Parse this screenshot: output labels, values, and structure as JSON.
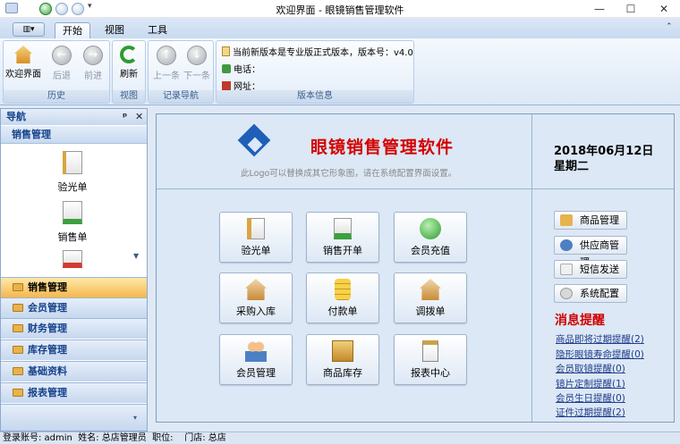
{
  "window": {
    "title": "欢迎界面 - 眼镜销售管理软件",
    "min": "—",
    "max": "☐",
    "close": "✕"
  },
  "tabs": [
    {
      "label": "开始"
    },
    {
      "label": "视图"
    },
    {
      "label": "工具"
    }
  ],
  "ribbon": {
    "history": {
      "label": "历史",
      "welcome": "欢迎界面",
      "back": "后退",
      "forward": "前进"
    },
    "view": {
      "label": "视图",
      "refresh": "刷新"
    },
    "nav": {
      "label": "记录导航",
      "prev": "上一条",
      "next": "下一条"
    },
    "version": {
      "label": "版本信息",
      "line1": "当前新版本是专业版正式版本，版本号：v4.0",
      "phone": "电话：",
      "site": "网址："
    }
  },
  "nav": {
    "header": "导航",
    "pin": "ᵖ",
    "close": "✕",
    "section": "销售管理",
    "items": [
      {
        "label": "验光单"
      },
      {
        "label": "销售单"
      }
    ],
    "groups": [
      {
        "label": "销售管理"
      },
      {
        "label": "会员管理"
      },
      {
        "label": "财务管理"
      },
      {
        "label": "库存管理"
      },
      {
        "label": "基础资料"
      },
      {
        "label": "报表管理"
      }
    ]
  },
  "main": {
    "brand": "眼镜销售管理软件",
    "logo_hint": "此Logo可以替换成其它形象图，请在系统配置界面设置。",
    "date": "2018年06月12日",
    "weekday": "星期二",
    "buttons": [
      {
        "label": "验光单"
      },
      {
        "label": "销售开单"
      },
      {
        "label": "会员充值"
      },
      {
        "label": "采购入库"
      },
      {
        "label": "付款单"
      },
      {
        "label": "调拨单"
      },
      {
        "label": "会员管理"
      },
      {
        "label": "商品库存"
      },
      {
        "label": "报表中心"
      }
    ],
    "side_buttons": [
      {
        "label": "商品管理"
      },
      {
        "label": "供应商管理"
      },
      {
        "label": "短信发送"
      },
      {
        "label": "系统配置"
      }
    ],
    "alert_title": "消息提醒",
    "alerts": [
      {
        "label": "商品即将过期提醒(2)"
      },
      {
        "label": "隐形眼镜寿命提醒(0)"
      },
      {
        "label": "会员取镜提醒(0)"
      },
      {
        "label": "镜片定制提醒(1)"
      },
      {
        "label": "会员生日提醒(0)"
      },
      {
        "label": "证件过期提醒(2)"
      }
    ]
  },
  "status": {
    "text": "登录账号: admin  姓名: 总店管理员  职位:    门店: 总店"
  },
  "colors": {
    "accent": "#1b3f8f",
    "alert_red": "#d10000",
    "brand_red": "#d40000"
  }
}
